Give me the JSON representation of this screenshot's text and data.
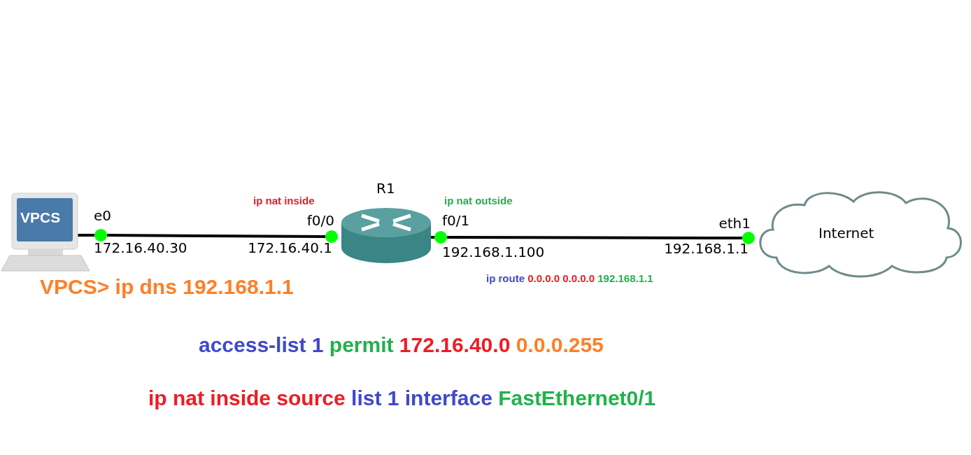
{
  "nodes": [
    {
      "kind": "vpcs",
      "label": "VPCS"
    },
    {
      "kind": "router",
      "label": "R1"
    },
    {
      "kind": "cloud",
      "label": "Internet"
    }
  ],
  "links": [
    {
      "ports": [
        {
          "name": "e0",
          "address": "172.16.40.30",
          "up": true
        },
        {
          "name": "f0/0",
          "address": "172.16.40.1",
          "up": true
        }
      ]
    },
    {
      "ports": [
        {
          "name": "f0/1",
          "address": "192.168.1.100",
          "up": true
        },
        {
          "name": "eth1",
          "address": "192.168.1.1",
          "up": true
        }
      ]
    }
  ],
  "notes": [
    {
      "kind": "small",
      "segments": [
        {
          "text": "ip nat inside",
          "color": "#ed1c24"
        }
      ]
    },
    {
      "kind": "small",
      "segments": [
        {
          "text": "ip nat outside",
          "color": "#22b14c"
        }
      ]
    },
    {
      "kind": "small",
      "segments": [
        {
          "text": "ip route",
          "color": "#3f48cc"
        },
        {
          "text": "0.0.0.0 0.0.0.0",
          "color": "#ed1c24"
        },
        {
          "text": "192.168.1.1",
          "color": "#22b14c"
        }
      ]
    },
    {
      "kind": "large",
      "segments": [
        {
          "text": "VPCS> ip dns 192.168.1.1",
          "color": "#ff7f27"
        }
      ]
    },
    {
      "kind": "large",
      "segments": [
        {
          "text": "access-list 1",
          "color": "#3f48cc"
        },
        {
          "text": "permit",
          "color": "#22b14c"
        },
        {
          "text": "172.16.40.0",
          "color": "#ed1c24"
        },
        {
          "text": "0.0.0.255",
          "color": "#ff7f27"
        }
      ]
    },
    {
      "kind": "large",
      "segments": [
        {
          "text": "ip nat inside source",
          "color": "#ed1c24"
        },
        {
          "text": "list 1 interface",
          "color": "#3f48cc"
        },
        {
          "text": "FastEthernet0/1",
          "color": "#22b14c"
        }
      ]
    }
  ]
}
